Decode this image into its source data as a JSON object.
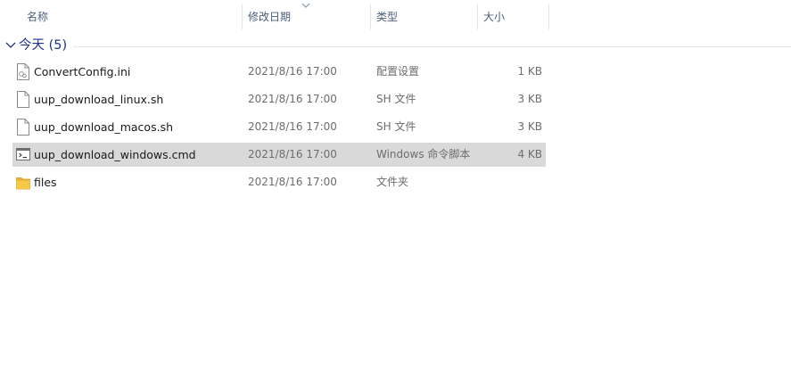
{
  "columns": {
    "name": "名称",
    "date": "修改日期",
    "type": "类型",
    "size": "大小"
  },
  "group": {
    "label": "今天 (5)"
  },
  "files": [
    {
      "name": "ConvertConfig.ini",
      "date": "2021/8/16 17:00",
      "type": "配置设置",
      "size": "1 KB",
      "icon": "document-icon"
    },
    {
      "name": "uup_download_linux.sh",
      "date": "2021/8/16 17:00",
      "type": "SH 文件",
      "size": "3 KB",
      "icon": "document-icon"
    },
    {
      "name": "uup_download_macos.sh",
      "date": "2021/8/16 17:00",
      "type": "SH 文件",
      "size": "3 KB",
      "icon": "document-icon"
    },
    {
      "name": "uup_download_windows.cmd",
      "date": "2021/8/16 17:00",
      "type": "Windows 命令脚本",
      "size": "4 KB",
      "icon": "script-icon",
      "selected": true
    },
    {
      "name": "files",
      "date": "2021/8/16 17:00",
      "type": "文件夹",
      "size": "",
      "icon": "folder-icon"
    }
  ],
  "colors": {
    "header_text": "#4c607a",
    "group_text": "#1e3287",
    "selected_row": "#d9d9d9",
    "folder": "#f4c542"
  }
}
